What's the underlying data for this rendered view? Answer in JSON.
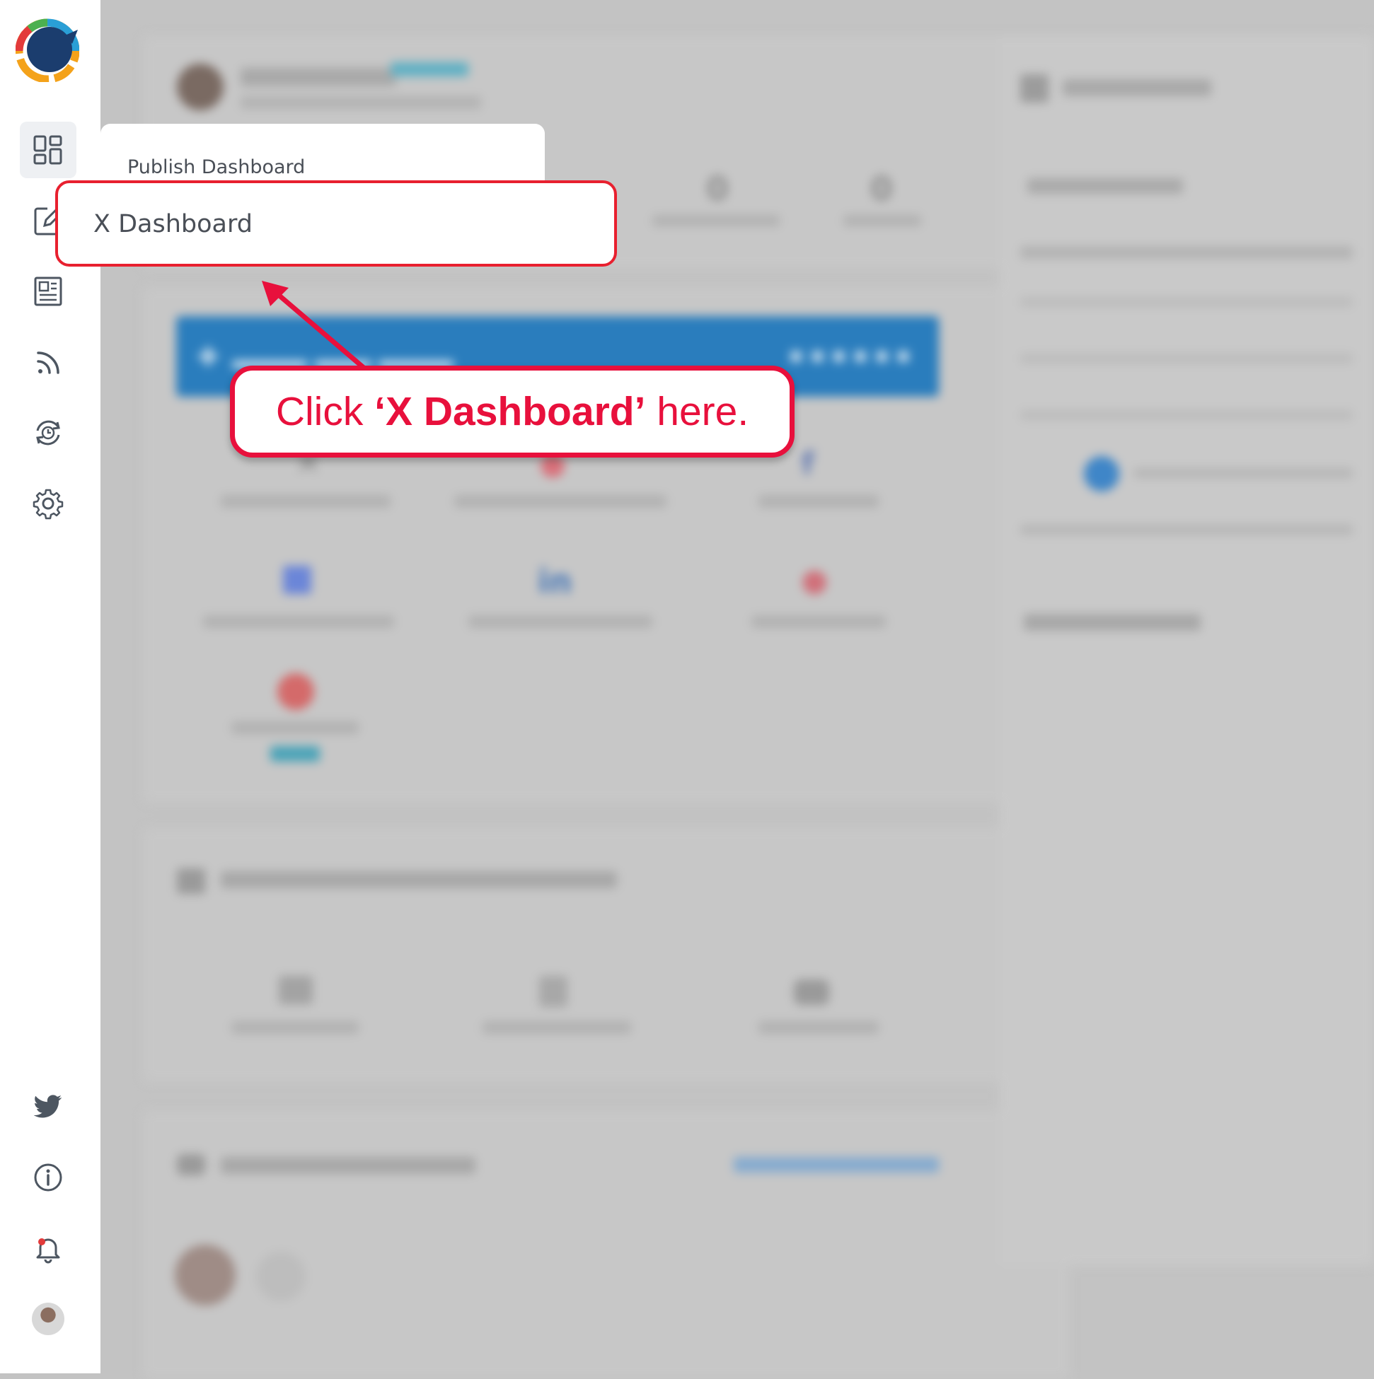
{
  "sidebar": {
    "items": [
      {
        "name": "dashboard",
        "icon": "dashboard-grid-icon",
        "active": true
      },
      {
        "name": "compose",
        "icon": "compose-icon"
      },
      {
        "name": "posts",
        "icon": "document-list-icon"
      },
      {
        "name": "feeds",
        "icon": "rss-icon"
      },
      {
        "name": "history",
        "icon": "refresh-clock-icon"
      },
      {
        "name": "settings",
        "icon": "gear-icon"
      }
    ],
    "bottom": [
      "twitter-icon",
      "info-icon",
      "bell-icon",
      "avatar"
    ]
  },
  "dropdown": {
    "title": "Publish Dashboard",
    "highlighted_item": "X Dashboard"
  },
  "callout": {
    "prefix": "Click ",
    "emphasis": "‘X Dashboard’",
    "suffix": " here."
  },
  "colors": {
    "highlight_red": "#e8103c",
    "overlay_gray": "#c3c3c3",
    "brand_blue": "#2a7dbd",
    "logo_navy": "#1b3d6e"
  }
}
